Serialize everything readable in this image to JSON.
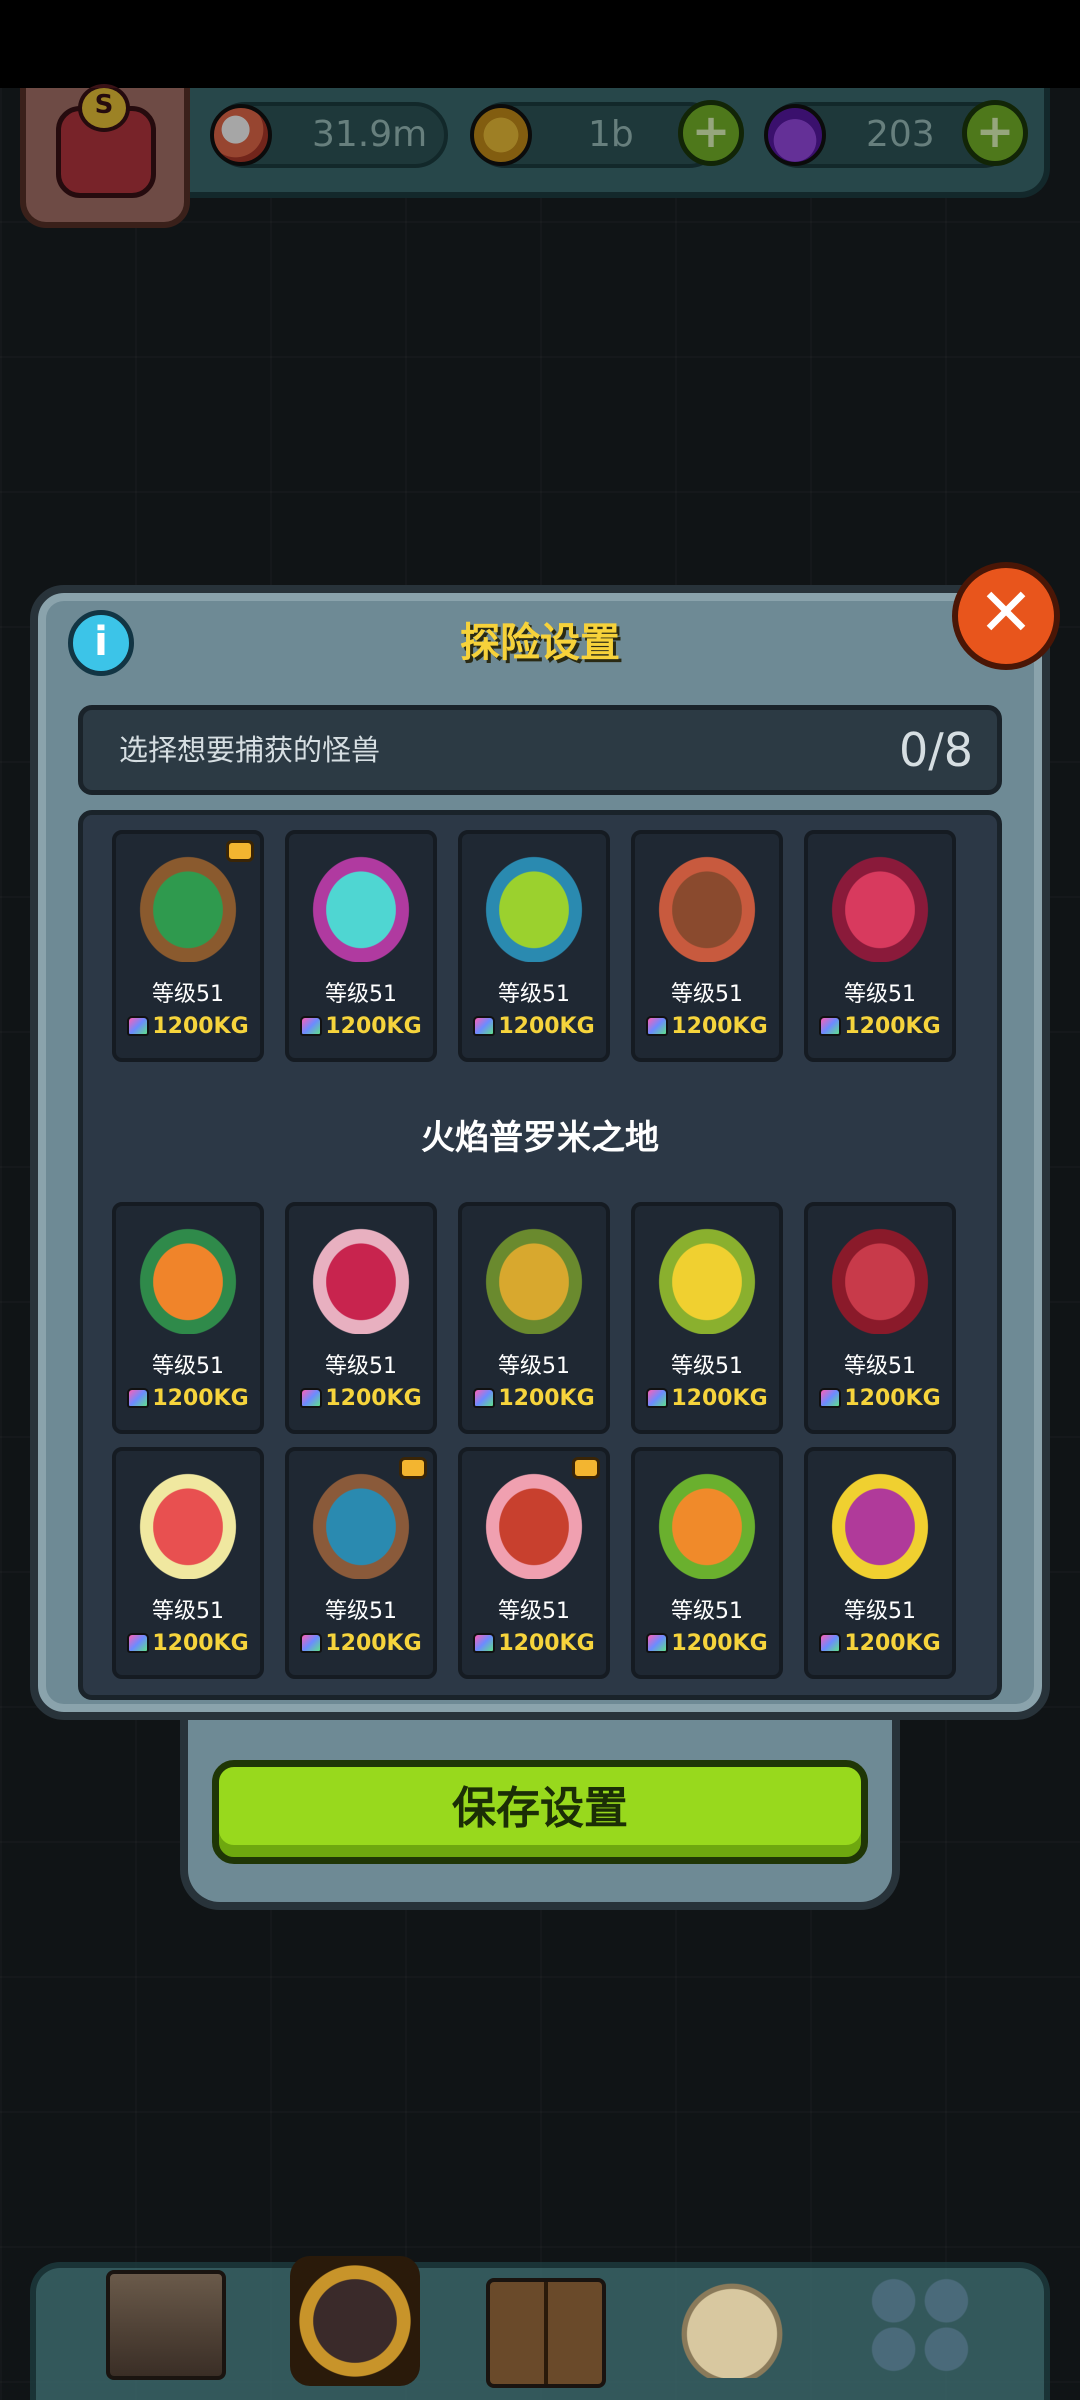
{
  "resources": [
    {
      "name": "eyes",
      "value": "31.9m",
      "icon": "eyeball-icon"
    },
    {
      "name": "coins",
      "value": "1b",
      "icon": "coin-icon"
    },
    {
      "name": "potions",
      "value": "203",
      "icon": "potion-icon"
    }
  ],
  "dialog": {
    "title": "探险设置",
    "select_label": "选择想要捕获的怪兽",
    "selected_count": "0/8",
    "region_name": "火焰普罗米之地",
    "save_label": "保存设置"
  },
  "monsters": [
    {
      "level": "等级51",
      "weight": "1200KG",
      "badge": true,
      "colors": [
        "#2f9a4e",
        "#8a5a2e"
      ]
    },
    {
      "level": "等级51",
      "weight": "1200KG",
      "badge": false,
      "colors": [
        "#4fd6d2",
        "#b03aa0"
      ]
    },
    {
      "level": "等级51",
      "weight": "1200KG",
      "badge": false,
      "colors": [
        "#9bd12e",
        "#2a8ab0"
      ]
    },
    {
      "level": "等级51",
      "weight": "1200KG",
      "badge": false,
      "colors": [
        "#8a4a2e",
        "#c85a3e"
      ]
    },
    {
      "level": "等级51",
      "weight": "1200KG",
      "badge": false,
      "colors": [
        "#d83a5e",
        "#8a1a3a"
      ]
    },
    {
      "level": "等级51",
      "weight": "1200KG",
      "badge": false,
      "colors": [
        "#f0842a",
        "#2f8a4a"
      ]
    },
    {
      "level": "等级51",
      "weight": "1200KG",
      "badge": false,
      "colors": [
        "#c8244e",
        "#e8b0c0"
      ]
    },
    {
      "level": "等级51",
      "weight": "1200KG",
      "badge": false,
      "colors": [
        "#d8a82e",
        "#6a8a2e"
      ]
    },
    {
      "level": "等级51",
      "weight": "1200KG",
      "badge": false,
      "colors": [
        "#f0d030",
        "#8ab02e"
      ]
    },
    {
      "level": "等级51",
      "weight": "1200KG",
      "badge": false,
      "colors": [
        "#c83a4a",
        "#8a1a2a"
      ]
    },
    {
      "level": "等级51",
      "weight": "1200KG",
      "badge": false,
      "colors": [
        "#e85050",
        "#f0e8a0"
      ]
    },
    {
      "level": "等级51",
      "weight": "1200KG",
      "badge": true,
      "colors": [
        "#2a8ab0",
        "#8a5a3a"
      ]
    },
    {
      "level": "等级51",
      "weight": "1200KG",
      "badge": true,
      "colors": [
        "#c8402e",
        "#f0a0b0"
      ]
    },
    {
      "level": "等级51",
      "weight": "1200KG",
      "badge": false,
      "colors": [
        "#f08a2a",
        "#6ab02e"
      ]
    },
    {
      "level": "等级51",
      "weight": "1200KG",
      "badge": false,
      "colors": [
        "#b03a9a",
        "#f0d030"
      ]
    }
  ],
  "nav": [
    {
      "name": "shop",
      "icon": "shop-icon"
    },
    {
      "name": "dungeon",
      "icon": "dungeon-icon"
    },
    {
      "name": "book",
      "icon": "book-icon"
    },
    {
      "name": "bag",
      "icon": "bag-icon"
    },
    {
      "name": "menu",
      "icon": "grid-menu-icon"
    }
  ]
}
